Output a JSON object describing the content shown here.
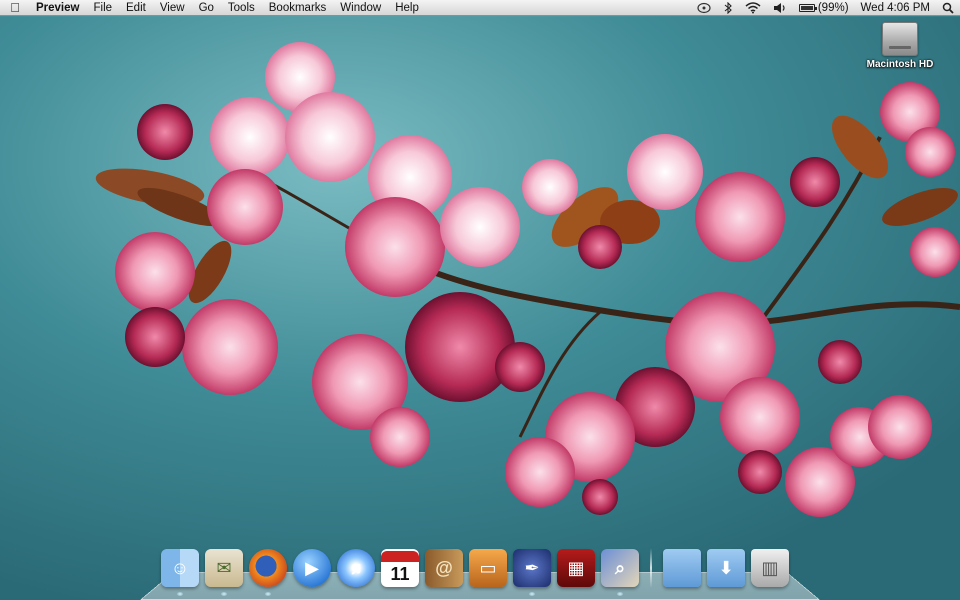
{
  "menubar": {
    "apple_icon": "apple-icon",
    "app_name": "Preview",
    "menus": [
      "File",
      "Edit",
      "View",
      "Go",
      "Tools",
      "Bookmarks",
      "Window",
      "Help"
    ],
    "status": {
      "battery_percent": "(99%)",
      "clock": "Wed 4:06 PM"
    }
  },
  "desktop": {
    "drive_label": "Macintosh HD"
  },
  "dock": {
    "items": [
      {
        "name": "Finder",
        "icon": "finder-icon",
        "running": true
      },
      {
        "name": "Mail",
        "icon": "mail-icon",
        "running": true
      },
      {
        "name": "Firefox",
        "icon": "firefox-icon",
        "running": true
      },
      {
        "name": "iChat",
        "icon": "ichat-icon",
        "running": false
      },
      {
        "name": "iTunes",
        "icon": "itunes-icon",
        "running": false
      },
      {
        "name": "iCal",
        "icon": "calendar-icon",
        "running": false,
        "badge": "11"
      },
      {
        "name": "Address Book",
        "icon": "address-book-icon",
        "running": false
      },
      {
        "name": "Keynote",
        "icon": "keynote-icon",
        "running": false
      },
      {
        "name": "Script Editor",
        "icon": "pen-icon",
        "running": true
      },
      {
        "name": "DVD Player",
        "icon": "dvd-icon",
        "running": false
      },
      {
        "name": "Preview",
        "icon": "preview-icon",
        "running": true
      },
      {
        "name": "Applications",
        "icon": "folder-icon",
        "running": false
      },
      {
        "name": "Downloads",
        "icon": "downloads-folder-icon",
        "running": false
      },
      {
        "name": "Trash",
        "icon": "trash-icon",
        "running": false
      }
    ]
  }
}
